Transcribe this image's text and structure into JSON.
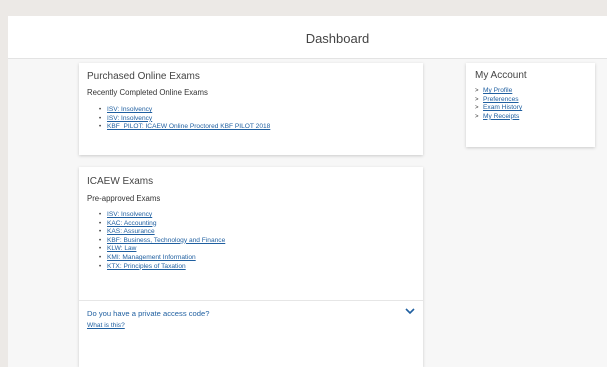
{
  "header": {
    "title": "Dashboard"
  },
  "purchased": {
    "title": "Purchased Online Exams",
    "subtitle": "Recently Completed Online Exams",
    "items": [
      "ISV: Insolvency",
      "ISV: Insolvency",
      "KBF_PILOT: ICAEW Online Proctored KBF PILOT 2018"
    ]
  },
  "account": {
    "title": "My Account",
    "items": [
      "My Profile",
      "Preferences",
      "Exam History",
      "My Receipts"
    ]
  },
  "icaew": {
    "title": "ICAEW Exams",
    "subtitle": "Pre-approved Exams",
    "items": [
      "ISV: Insolvency",
      "KAC: Accounting",
      "KAS: Assurance",
      "KBF: Business, Technology and Finance",
      "KLW: Law",
      "KMI: Management Information",
      "KTX: Principles of Taxation"
    ],
    "access_question": "Do you have a private access code?",
    "what_is_this": "What is this?"
  },
  "icons": {
    "bullet": "bullet-icon",
    "account_chevron": "chevron-right-icon",
    "expand": "chevron-down-icon"
  },
  "colors": {
    "link": "#1f5fa0",
    "background": "#ece9e6",
    "card": "#ffffff"
  }
}
